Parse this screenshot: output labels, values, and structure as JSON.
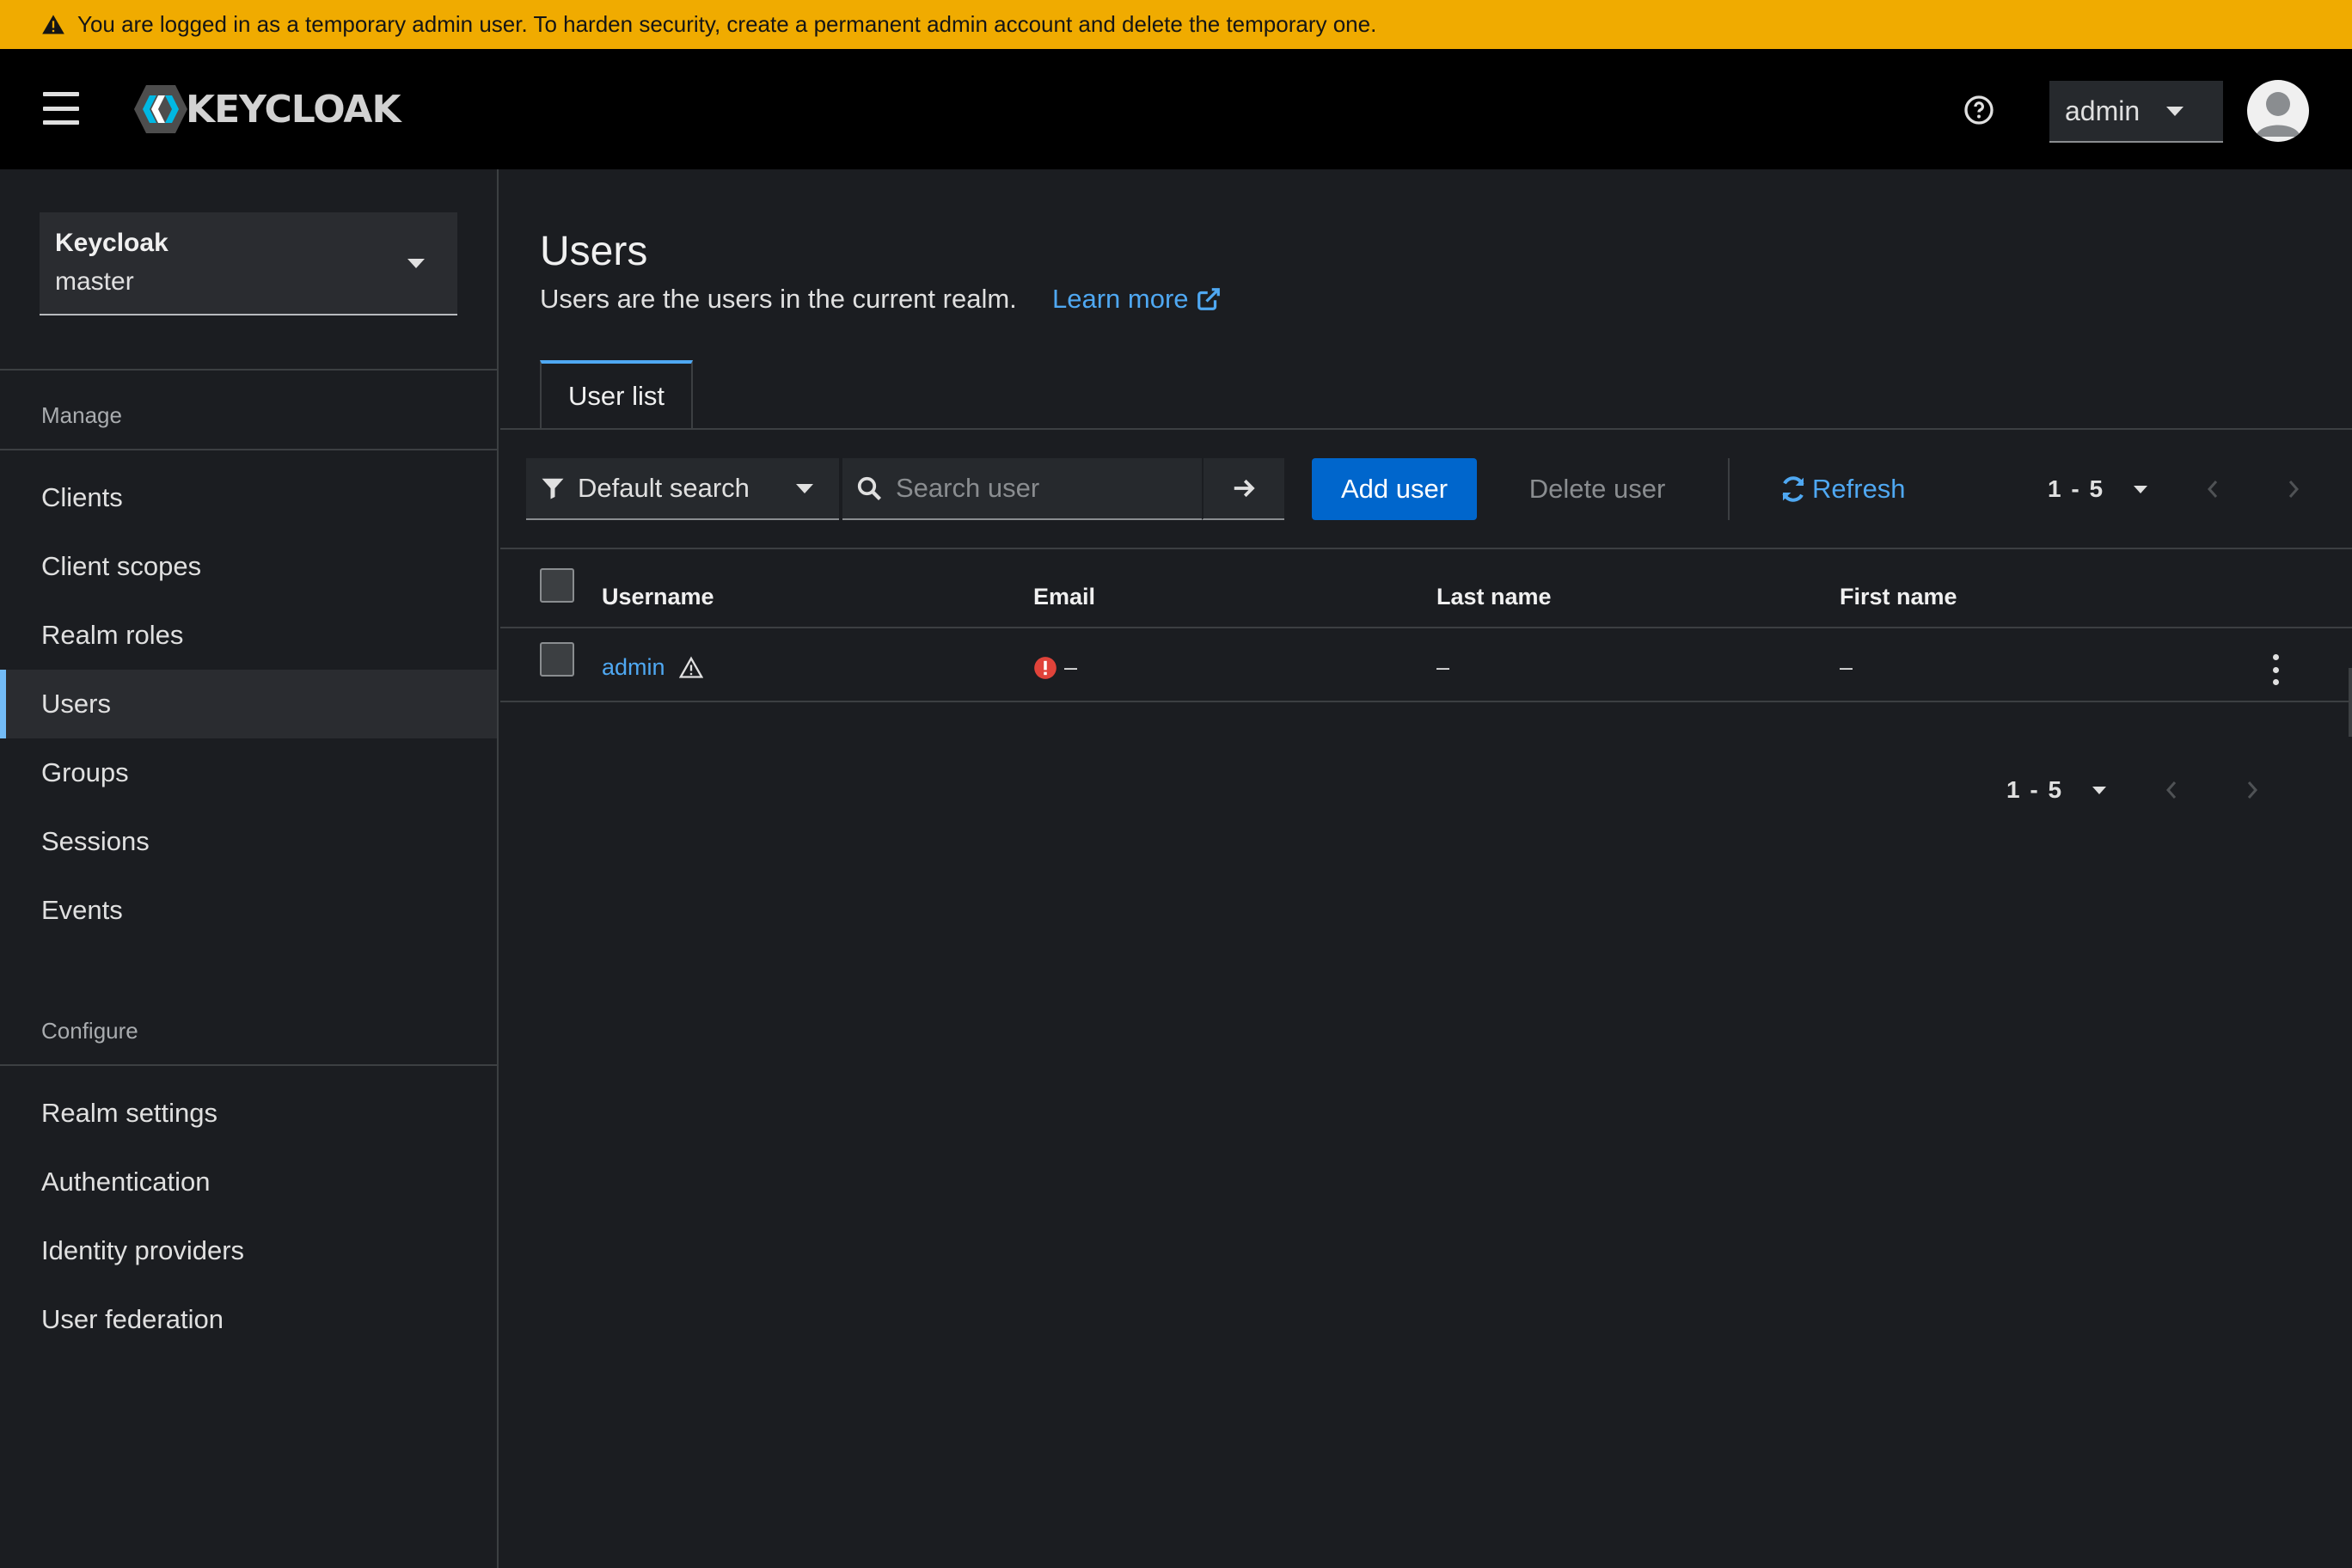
{
  "banner": {
    "text": "You are logged in as a temporary admin user. To harden security, create a permanent admin account and delete the temporary one.",
    "icon": "warning-triangle-icon",
    "color": "#f0ab00"
  },
  "header": {
    "logo_text": "KEYCLOAK",
    "user_menu_label": "admin",
    "help_icon": "question-circle-icon"
  },
  "realm_selector": {
    "name": "Keycloak",
    "realm": "master"
  },
  "sidebar": {
    "manage_title": "Manage",
    "manage_items": [
      {
        "label": "Clients"
      },
      {
        "label": "Client scopes"
      },
      {
        "label": "Realm roles"
      },
      {
        "label": "Users",
        "active": true
      },
      {
        "label": "Groups"
      },
      {
        "label": "Sessions"
      },
      {
        "label": "Events"
      }
    ],
    "configure_title": "Configure",
    "configure_items": [
      {
        "label": "Realm settings"
      },
      {
        "label": "Authentication"
      },
      {
        "label": "Identity providers"
      },
      {
        "label": "User federation"
      }
    ]
  },
  "page": {
    "title": "Users",
    "subtitle": "Users are the users in the current realm.",
    "learn_more": "Learn more"
  },
  "tabs": [
    {
      "label": "User list"
    }
  ],
  "toolbar": {
    "filter_label": "Default search",
    "search_placeholder": "Search user",
    "add_user": "Add user",
    "delete_user": "Delete user",
    "refresh": "Refresh",
    "pagination_range": "1 - 5"
  },
  "table": {
    "columns": [
      "Username",
      "Email",
      "Last name",
      "First name"
    ],
    "rows": [
      {
        "username": "admin",
        "email": "–",
        "last_name": "–",
        "first_name": "–"
      }
    ]
  },
  "footer_pagination": {
    "range": "1 - 5"
  },
  "colors": {
    "accent": "#0066cc",
    "link": "#4fa8f2",
    "active_nav_bar": "#73bcf7",
    "error": "#c9190b"
  }
}
